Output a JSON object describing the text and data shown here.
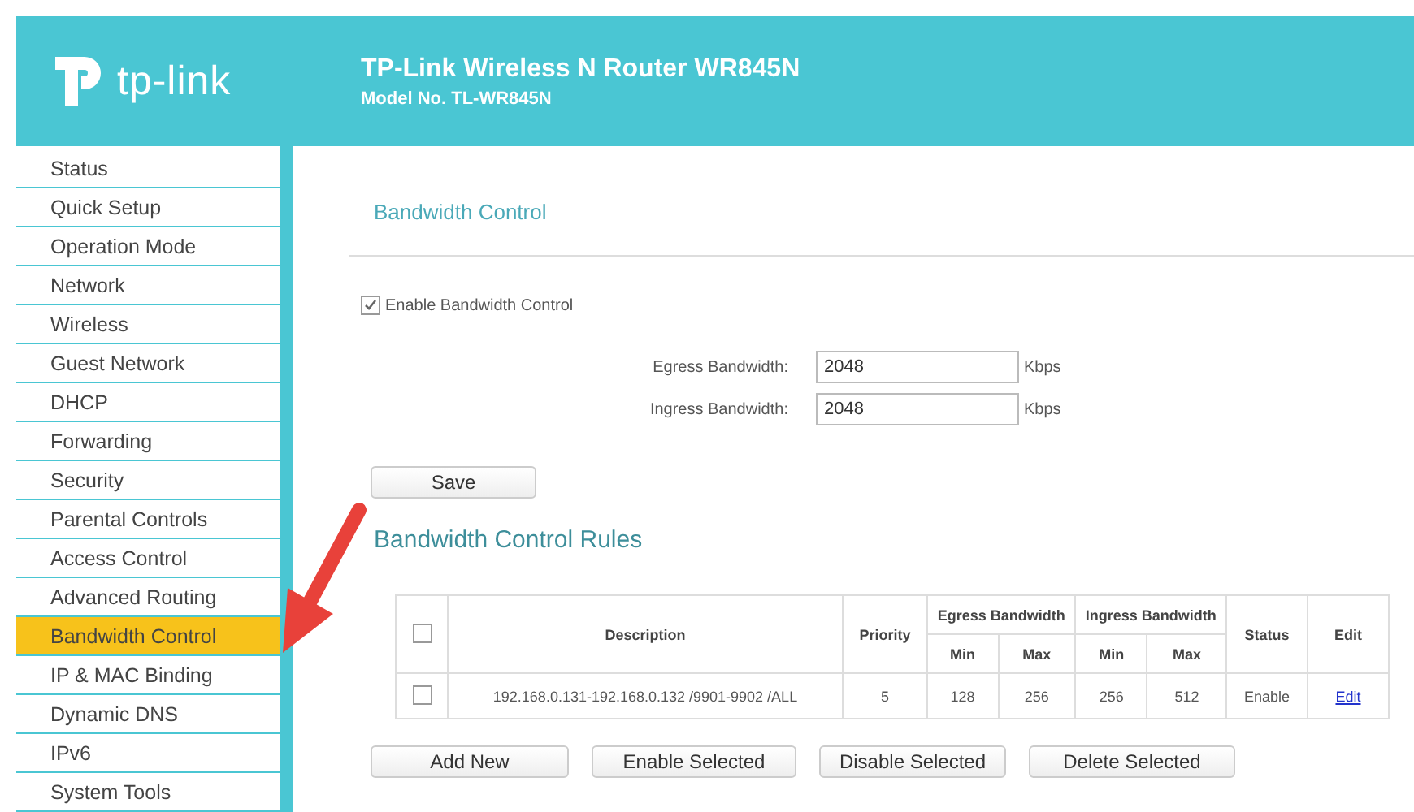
{
  "header": {
    "logo": "tp-link",
    "title": "TP-Link Wireless N Router WR845N",
    "model": "Model No. TL-WR845N"
  },
  "sidebar": {
    "items": [
      {
        "label": "Status",
        "selected": false
      },
      {
        "label": "Quick Setup",
        "selected": false
      },
      {
        "label": "Operation Mode",
        "selected": false
      },
      {
        "label": "Network",
        "selected": false
      },
      {
        "label": "Wireless",
        "selected": false
      },
      {
        "label": "Guest Network",
        "selected": false
      },
      {
        "label": "DHCP",
        "selected": false
      },
      {
        "label": "Forwarding",
        "selected": false
      },
      {
        "label": "Security",
        "selected": false
      },
      {
        "label": "Parental Controls",
        "selected": false
      },
      {
        "label": "Access Control",
        "selected": false
      },
      {
        "label": "Advanced Routing",
        "selected": false
      },
      {
        "label": "Bandwidth Control",
        "selected": true
      },
      {
        "label": "IP & MAC Binding",
        "selected": false
      },
      {
        "label": "Dynamic DNS",
        "selected": false
      },
      {
        "label": "IPv6",
        "selected": false
      },
      {
        "label": "System Tools",
        "selected": false
      }
    ]
  },
  "page_title": "Bandwidth Control",
  "enable": {
    "label": "Enable Bandwidth Control",
    "checked": true
  },
  "fields": [
    {
      "label": "Egress Bandwidth:",
      "value": "2048",
      "unit": "Kbps"
    },
    {
      "label": "Ingress Bandwidth:",
      "value": "2048",
      "unit": "Kbps"
    }
  ],
  "save_button": "Save",
  "rules_title": "Bandwidth Control Rules",
  "table": {
    "header_rows": [
      [
        {
          "kind": "checkbox",
          "checked": false,
          "rowspan": 2
        },
        {
          "kind": "text",
          "label": "Description",
          "rowspan": 2
        },
        {
          "kind": "text",
          "label": "Priority",
          "rowspan": 2
        },
        {
          "kind": "text",
          "label": "Egress Bandwidth",
          "colspan": 2
        },
        {
          "kind": "text",
          "label": "Ingress Bandwidth",
          "colspan": 2
        },
        {
          "kind": "text",
          "label": "Status",
          "rowspan": 2
        },
        {
          "kind": "text",
          "label": "Edit",
          "rowspan": 2
        }
      ],
      [
        {
          "kind": "text",
          "label": "Min"
        },
        {
          "kind": "text",
          "label": "Max"
        },
        {
          "kind": "text",
          "label": "Min"
        },
        {
          "kind": "text",
          "label": "Max"
        }
      ]
    ],
    "rows": [
      [
        {
          "kind": "checkbox",
          "checked": false
        },
        {
          "kind": "text",
          "text": "192.168.0.131-192.168.0.132 /9901-9902 /ALL"
        },
        {
          "kind": "text",
          "text": "5"
        },
        {
          "kind": "text",
          "text": "128"
        },
        {
          "kind": "text",
          "text": "256"
        },
        {
          "kind": "text",
          "text": "256"
        },
        {
          "kind": "text",
          "text": "512"
        },
        {
          "kind": "text",
          "text": "Enable"
        },
        {
          "kind": "link",
          "text": "Edit"
        }
      ]
    ]
  },
  "buttons": [
    "Add New",
    "Enable Selected",
    "Disable Selected",
    "Delete Selected"
  ]
}
